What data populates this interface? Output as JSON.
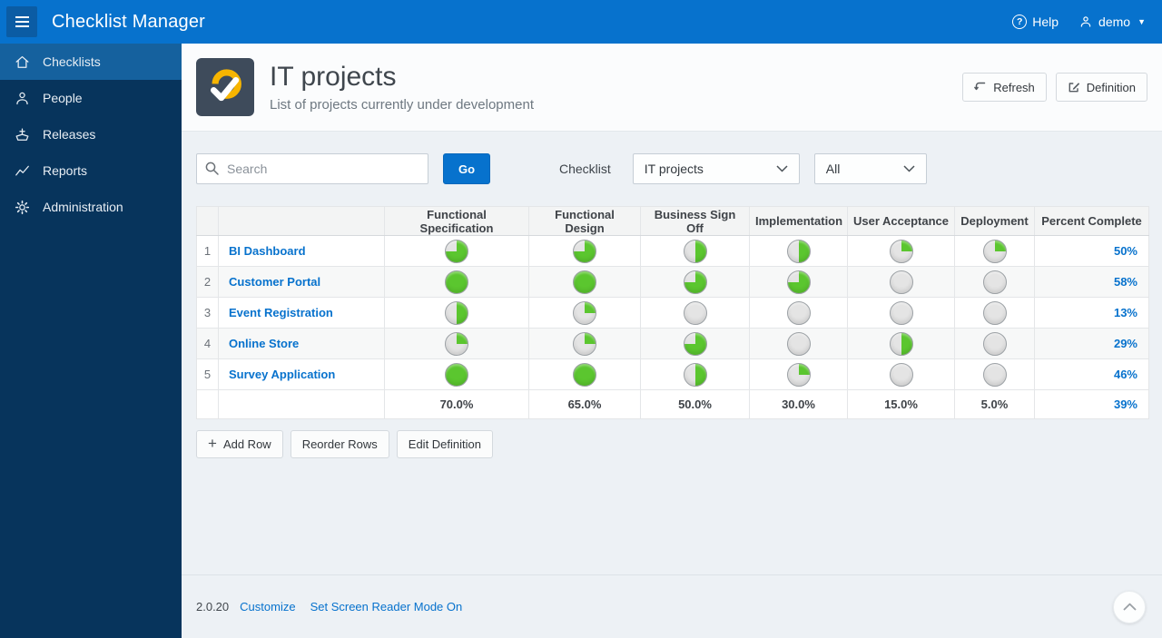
{
  "app": {
    "title": "Checklist Manager",
    "help_label": "Help",
    "user_label": "demo"
  },
  "sidebar": {
    "items": [
      {
        "label": "Checklists",
        "icon": "home-icon",
        "active": true
      },
      {
        "label": "People",
        "icon": "user-icon",
        "active": false
      },
      {
        "label": "Releases",
        "icon": "ship-icon",
        "active": false
      },
      {
        "label": "Reports",
        "icon": "chart-icon",
        "active": false
      },
      {
        "label": "Administration",
        "icon": "gear-icon",
        "active": false
      }
    ]
  },
  "hero": {
    "title": "IT projects",
    "subtitle": "List of projects currently under development",
    "refresh_label": "Refresh",
    "definition_label": "Definition"
  },
  "toolbar": {
    "search_placeholder": "Search",
    "go_label": "Go",
    "checklist_label": "Checklist",
    "checklist_value": "IT projects",
    "filter_value": "All"
  },
  "table": {
    "columns": [
      "",
      "",
      "Functional Specification",
      "Functional Design",
      "Business Sign Off",
      "Implementation",
      "User Acceptance",
      "Deployment",
      "Percent Complete"
    ],
    "rows": [
      {
        "num": "1",
        "name": "BI Dashboard",
        "stages": [
          75,
          75,
          50,
          50,
          25,
          25
        ],
        "percent": "50%"
      },
      {
        "num": "2",
        "name": "Customer Portal",
        "stages": [
          100,
          100,
          75,
          75,
          0,
          0
        ],
        "percent": "58%"
      },
      {
        "num": "3",
        "name": "Event Registration",
        "stages": [
          50,
          25,
          0,
          0,
          0,
          0
        ],
        "percent": "13%"
      },
      {
        "num": "4",
        "name": "Online Store",
        "stages": [
          25,
          25,
          75,
          0,
          50,
          0
        ],
        "percent": "29%"
      },
      {
        "num": "5",
        "name": "Survey Application",
        "stages": [
          100,
          100,
          50,
          25,
          0,
          0
        ],
        "percent": "46%"
      }
    ],
    "footer": {
      "averages": [
        "70.0%",
        "65.0%",
        "50.0%",
        "30.0%",
        "15.0%",
        "5.0%"
      ],
      "total": "39%"
    }
  },
  "actions": {
    "add_row": "Add Row",
    "reorder_rows": "Reorder Rows",
    "edit_definition": "Edit Definition"
  },
  "footer": {
    "version": "2.0.20",
    "customize": "Customize",
    "screen_reader": "Set Screen Reader Mode On"
  },
  "colors": {
    "brand_blue": "#0772CD",
    "topbar_button_bg": "#0B5CA4",
    "sidebar_bg": "#07345C",
    "sidebar_active_bg": "#15619E",
    "content_bg": "#EDF1F5",
    "hero_bg": "#FBFCFD",
    "icon_tile_bg": "#3E4B5B",
    "icon_arc": "#F7B500",
    "pie_green": "#5BC62F",
    "pie_gray": "#E4E4E4",
    "link_blue": "#0772CD"
  }
}
